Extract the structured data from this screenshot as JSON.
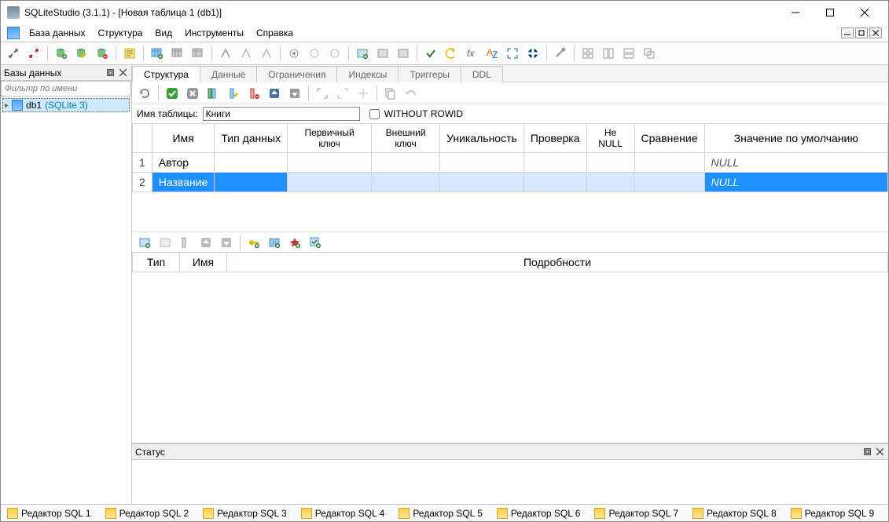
{
  "titlebar": {
    "title": "SQLiteStudio (3.1.1) - [Новая таблица 1 (db1)]"
  },
  "menu": {
    "database": "База данных",
    "structure": "Структура",
    "view": "Вид",
    "tools": "Инструменты",
    "help": "Справка"
  },
  "sidebar": {
    "header": "Базы данных",
    "filter_placeholder": "Фильтр по имени",
    "db_name": "db1",
    "db_type": "(SQLite 3)"
  },
  "tabs": {
    "structure": "Структура",
    "data": "Данные",
    "constraints": "Ограничения",
    "indexes": "Индексы",
    "triggers": "Триггеры",
    "ddl": "DDL"
  },
  "table_name": {
    "label": "Имя таблицы:",
    "value": "Книги",
    "without_rowid": "WITHOUT ROWID"
  },
  "columns_grid": {
    "headers": {
      "name": "Имя",
      "type": "Тип данных",
      "pk": "Первичный ключ",
      "fk": "Внешний ключ",
      "unique": "Уникальность",
      "check": "Проверка",
      "notnull": "Не NULL",
      "collate": "Сравнение",
      "default": "Значение по умолчанию"
    },
    "rows": [
      {
        "num": "1",
        "name": "Автор",
        "default": "NULL"
      },
      {
        "num": "2",
        "name": "Название",
        "default": "NULL"
      }
    ]
  },
  "details_grid": {
    "type": "Тип",
    "name": "Имя",
    "details": "Подробности"
  },
  "status_header": "Статус",
  "bottom_tabs": [
    "Редактор SQL 1",
    "Редактор SQL 2",
    "Редактор SQL 3",
    "Редактор SQL 4",
    "Редактор SQL 5",
    "Редактор SQL 6",
    "Редактор SQL 7",
    "Редактор SQL 8",
    "Редактор SQL 9"
  ]
}
